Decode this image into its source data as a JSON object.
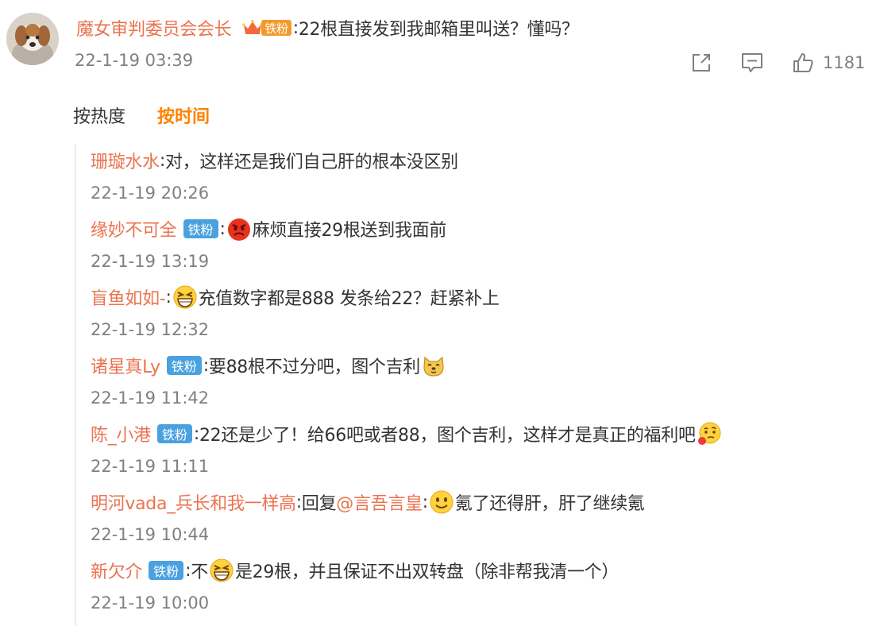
{
  "top_comment": {
    "username": "魔女审判委员会会长",
    "badge": "铁粉",
    "separator": ":",
    "text": "22根直接发到我邮箱里叫送？懂吗？",
    "time": "22-1-19 03:39",
    "like_count": "1181",
    "icons": [
      "share-icon",
      "comment-icon",
      "like-icon"
    ]
  },
  "sort_tabs": {
    "hot": "按热度",
    "time": "按时间"
  },
  "replies": [
    {
      "username": "珊璇水水",
      "badge": "",
      "sep": ":",
      "emoji_before": "",
      "text": "对，这样还是我们自己肝的根本没区别",
      "emoji_after": "",
      "time": "22-1-19 20:26"
    },
    {
      "username": "缘妙不可全",
      "badge": "铁粉",
      "sep": ":",
      "emoji_before": "angry-face-emoji",
      "text": "麻烦直接29根送到我面前",
      "emoji_after": "",
      "time": "22-1-19 13:19"
    },
    {
      "username": "盲鱼如如-",
      "badge": "",
      "sep": ":",
      "emoji_before": "grinning-squint-emoji",
      "text": "充值数字都是888 发条给22？赶紧补上",
      "emoji_after": "",
      "time": "22-1-19 12:32"
    },
    {
      "username": "诸星真Ly",
      "badge": "铁粉",
      "sep": ":",
      "emoji_before": "",
      "text": "要88根不过分吧，图个吉利",
      "emoji_after": "doge-emoji",
      "time": "22-1-19 11:42"
    },
    {
      "username": "陈_小港",
      "badge": "铁粉",
      "sep": ":",
      "emoji_before": "",
      "text": "22还是少了！给66吧或者88，图个吉利，这样才是真正的福利吧",
      "emoji_after": "thinking-emoji",
      "time": "22-1-19 11:11"
    },
    {
      "username": "明河vada_兵长和我一样高",
      "badge": "",
      "sep": ":",
      "reply_prefix": "回复",
      "mention": "@言吾言皇",
      "mention_sep": ":",
      "emoji_before": "smile-emoji",
      "text": "氪了还得肝，肝了继续氪",
      "emoji_after": "",
      "time": "22-1-19 10:44"
    },
    {
      "username": "新欠介",
      "badge": "铁粉",
      "sep": ":",
      "text_before": "不",
      "emoji_before": "grinning-squint-emoji",
      "text": "是29根，并且保证不出双转盘（除非帮我清一个）",
      "emoji_after": "",
      "time": "22-1-19 10:00"
    }
  ]
}
